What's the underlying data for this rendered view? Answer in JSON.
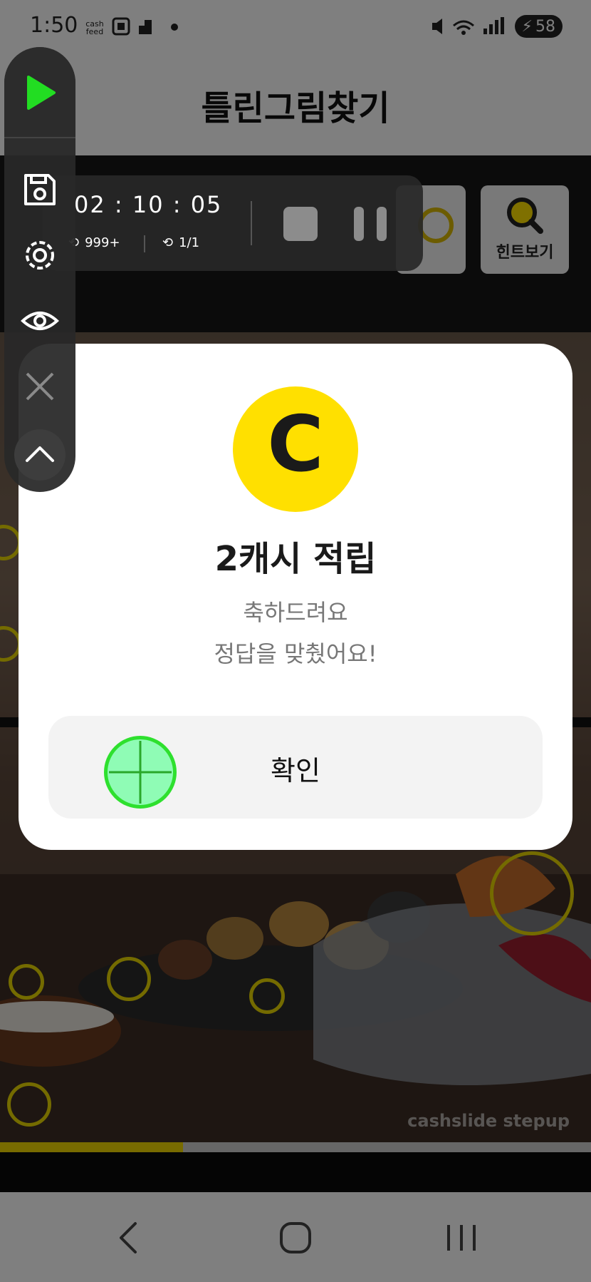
{
  "status_bar": {
    "time": "1:50",
    "brand_icon": "cash feed",
    "battery": "58"
  },
  "header": {
    "title": "틀린그림찾기"
  },
  "toolbar": {
    "hint_label": "힌트보기"
  },
  "image": {
    "watermark": "cashslide stepup"
  },
  "progress": {
    "fraction": 0.31
  },
  "recorder": {
    "timer": "02 : 10 : 05",
    "loop_count": "999+",
    "repeat_count": "1/1"
  },
  "modal": {
    "coin_letter": "C",
    "title": "2캐시 적립",
    "message_line1": "축하드려요",
    "message_line2": "정답을 맞췄어요!",
    "confirm_label": "확인"
  },
  "colors": {
    "accent_yellow": "#ffe000",
    "record_green": "#22dd22",
    "marker_yellow": "#e8d600"
  }
}
